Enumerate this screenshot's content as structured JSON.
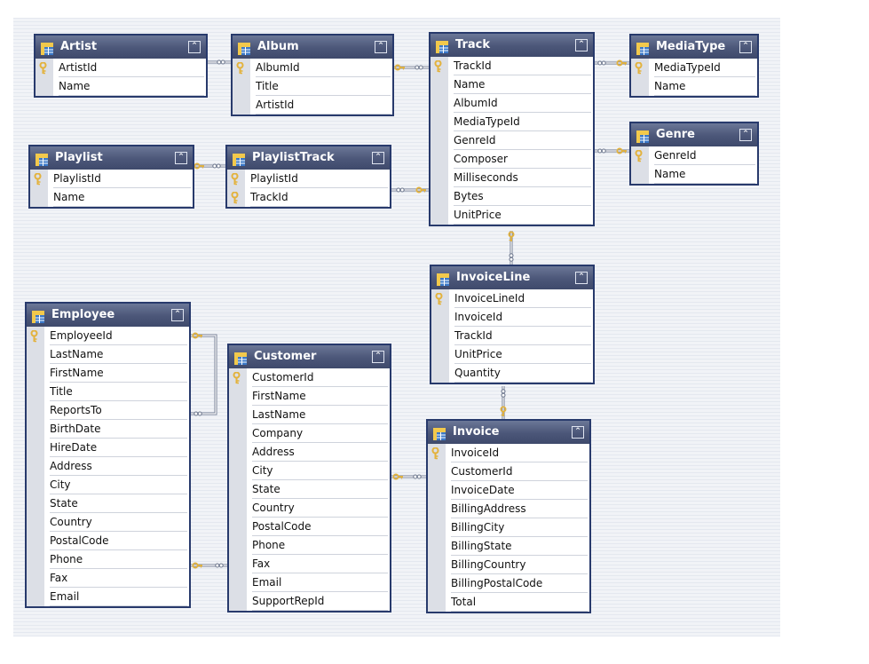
{
  "tables": [
    {
      "id": "artist",
      "name": "Artist",
      "fields": [
        {
          "name": "ArtistId",
          "pk": true
        },
        {
          "name": "Name",
          "pk": false
        }
      ]
    },
    {
      "id": "album",
      "name": "Album",
      "fields": [
        {
          "name": "AlbumId",
          "pk": true
        },
        {
          "name": "Title",
          "pk": false
        },
        {
          "name": "ArtistId",
          "pk": false
        }
      ]
    },
    {
      "id": "track",
      "name": "Track",
      "fields": [
        {
          "name": "TrackId",
          "pk": true
        },
        {
          "name": "Name",
          "pk": false
        },
        {
          "name": "AlbumId",
          "pk": false
        },
        {
          "name": "MediaTypeId",
          "pk": false
        },
        {
          "name": "GenreId",
          "pk": false
        },
        {
          "name": "Composer",
          "pk": false
        },
        {
          "name": "Milliseconds",
          "pk": false
        },
        {
          "name": "Bytes",
          "pk": false
        },
        {
          "name": "UnitPrice",
          "pk": false
        }
      ]
    },
    {
      "id": "mediatype",
      "name": "MediaType",
      "fields": [
        {
          "name": "MediaTypeId",
          "pk": true
        },
        {
          "name": "Name",
          "pk": false
        }
      ]
    },
    {
      "id": "genre",
      "name": "Genre",
      "fields": [
        {
          "name": "GenreId",
          "pk": true
        },
        {
          "name": "Name",
          "pk": false
        }
      ]
    },
    {
      "id": "playlist",
      "name": "Playlist",
      "fields": [
        {
          "name": "PlaylistId",
          "pk": true
        },
        {
          "name": "Name",
          "pk": false
        }
      ]
    },
    {
      "id": "playlisttrack",
      "name": "PlaylistTrack",
      "fields": [
        {
          "name": "PlaylistId",
          "pk": true
        },
        {
          "name": "TrackId",
          "pk": true
        }
      ]
    },
    {
      "id": "invoiceline",
      "name": "InvoiceLine",
      "fields": [
        {
          "name": "InvoiceLineId",
          "pk": true
        },
        {
          "name": "InvoiceId",
          "pk": false
        },
        {
          "name": "TrackId",
          "pk": false
        },
        {
          "name": "UnitPrice",
          "pk": false
        },
        {
          "name": "Quantity",
          "pk": false
        }
      ]
    },
    {
      "id": "employee",
      "name": "Employee",
      "fields": [
        {
          "name": "EmployeeId",
          "pk": true
        },
        {
          "name": "LastName",
          "pk": false
        },
        {
          "name": "FirstName",
          "pk": false
        },
        {
          "name": "Title",
          "pk": false
        },
        {
          "name": "ReportsTo",
          "pk": false
        },
        {
          "name": "BirthDate",
          "pk": false
        },
        {
          "name": "HireDate",
          "pk": false
        },
        {
          "name": "Address",
          "pk": false
        },
        {
          "name": "City",
          "pk": false
        },
        {
          "name": "State",
          "pk": false
        },
        {
          "name": "Country",
          "pk": false
        },
        {
          "name": "PostalCode",
          "pk": false
        },
        {
          "name": "Phone",
          "pk": false
        },
        {
          "name": "Fax",
          "pk": false
        },
        {
          "name": "Email",
          "pk": false
        }
      ]
    },
    {
      "id": "customer",
      "name": "Customer",
      "fields": [
        {
          "name": "CustomerId",
          "pk": true
        },
        {
          "name": "FirstName",
          "pk": false
        },
        {
          "name": "LastName",
          "pk": false
        },
        {
          "name": "Company",
          "pk": false
        },
        {
          "name": "Address",
          "pk": false
        },
        {
          "name": "City",
          "pk": false
        },
        {
          "name": "State",
          "pk": false
        },
        {
          "name": "Country",
          "pk": false
        },
        {
          "name": "PostalCode",
          "pk": false
        },
        {
          "name": "Phone",
          "pk": false
        },
        {
          "name": "Fax",
          "pk": false
        },
        {
          "name": "Email",
          "pk": false
        },
        {
          "name": "SupportRepId",
          "pk": false
        }
      ]
    },
    {
      "id": "invoice",
      "name": "Invoice",
      "fields": [
        {
          "name": "InvoiceId",
          "pk": true
        },
        {
          "name": "CustomerId",
          "pk": false
        },
        {
          "name": "InvoiceDate",
          "pk": false
        },
        {
          "name": "BillingAddress",
          "pk": false
        },
        {
          "name": "BillingCity",
          "pk": false
        },
        {
          "name": "BillingState",
          "pk": false
        },
        {
          "name": "BillingCountry",
          "pk": false
        },
        {
          "name": "BillingPostalCode",
          "pk": false
        },
        {
          "name": "Total",
          "pk": false
        }
      ]
    }
  ],
  "relationships": [
    {
      "name": "artist-album",
      "one": "artist",
      "many": "album"
    },
    {
      "name": "album-track",
      "one": "album",
      "many": "track"
    },
    {
      "name": "mediatype-track",
      "one": "mediatype",
      "many": "track"
    },
    {
      "name": "genre-track",
      "one": "genre",
      "many": "track"
    },
    {
      "name": "playlist-playlisttrack",
      "one": "playlist",
      "many": "playlisttrack"
    },
    {
      "name": "track-playlisttrack",
      "one": "track",
      "many": "playlisttrack"
    },
    {
      "name": "track-invoiceline",
      "one": "track",
      "many": "invoiceline"
    },
    {
      "name": "invoice-invoiceline",
      "one": "invoice",
      "many": "invoiceline"
    },
    {
      "name": "employee-reportsto",
      "one": "employee",
      "many": "employee"
    },
    {
      "name": "employee-customer",
      "one": "employee",
      "many": "customer"
    },
    {
      "name": "customer-invoice",
      "one": "customer",
      "many": "invoice"
    }
  ],
  "icons": {
    "table": "table-icon",
    "primary_key": "key-icon",
    "collapse": "collapse-icon",
    "one_end": "key-icon",
    "many_end": "infinity-icon"
  },
  "colors": {
    "header": "#4b5678",
    "border": "#283a6c",
    "key": "#e3b23c",
    "line": "#ffffff",
    "canvas": "#e9ecf2"
  }
}
